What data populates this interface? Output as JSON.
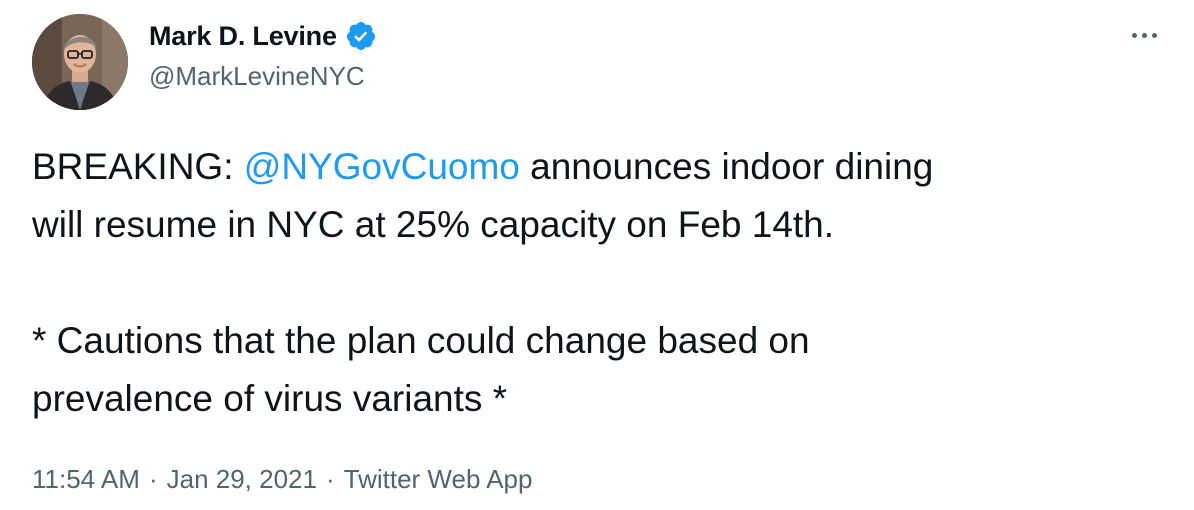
{
  "author": {
    "display_name": "Mark D. Levine",
    "handle": "@MarkLevineNYC",
    "verified": true,
    "avatar_icon": "profile-photo"
  },
  "more_icon": "more-dots-icon",
  "tweet": {
    "line1_prefix": "BREAKING: ",
    "mention": "@NYGovCuomo",
    "line1_suffix": " announces indoor dining",
    "line2": "will resume in NYC at 25% capacity on Feb 14th.",
    "line3": "* Cautions that the plan could change based on",
    "line4": "prevalence of virus variants *"
  },
  "meta": {
    "time": "11:54 AM",
    "separator": "·",
    "date": "Jan 29, 2021",
    "source": "Twitter Web App"
  },
  "colors": {
    "link": "#1d9bf0",
    "verified_badge": "#1d9bf0",
    "secondary_text": "#536471",
    "primary_text": "#0f1419"
  }
}
